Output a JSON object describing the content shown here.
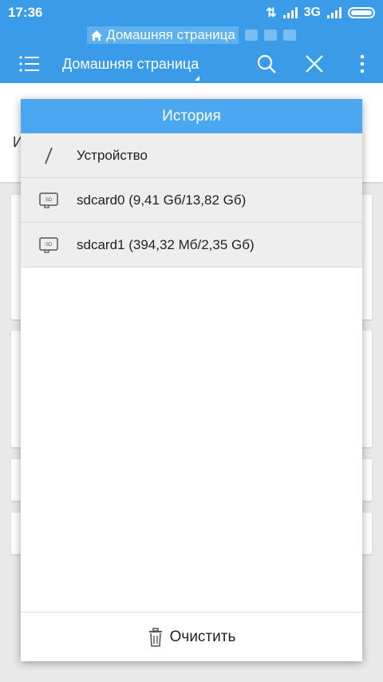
{
  "status": {
    "time": "17:36",
    "network": "3G"
  },
  "tabs": {
    "active_label": "Домашняя страница"
  },
  "toolbar": {
    "title": "Домашняя страница"
  },
  "background": {
    "partial_text": "И"
  },
  "dialog": {
    "title": "История",
    "items": [
      {
        "label": "Устройство",
        "icon": "root-slash-icon"
      },
      {
        "label": "sdcard0 (9,41 Gб/13,82 Gб)",
        "icon": "sd-card-icon"
      },
      {
        "label": "sdcard1 (394,32 Мб/2,35 Gб)",
        "icon": "sd-card-icon"
      }
    ],
    "clear_label": "Очистить"
  },
  "colors": {
    "primary": "#3a9be8",
    "dialog_header": "#4aa7f0"
  }
}
